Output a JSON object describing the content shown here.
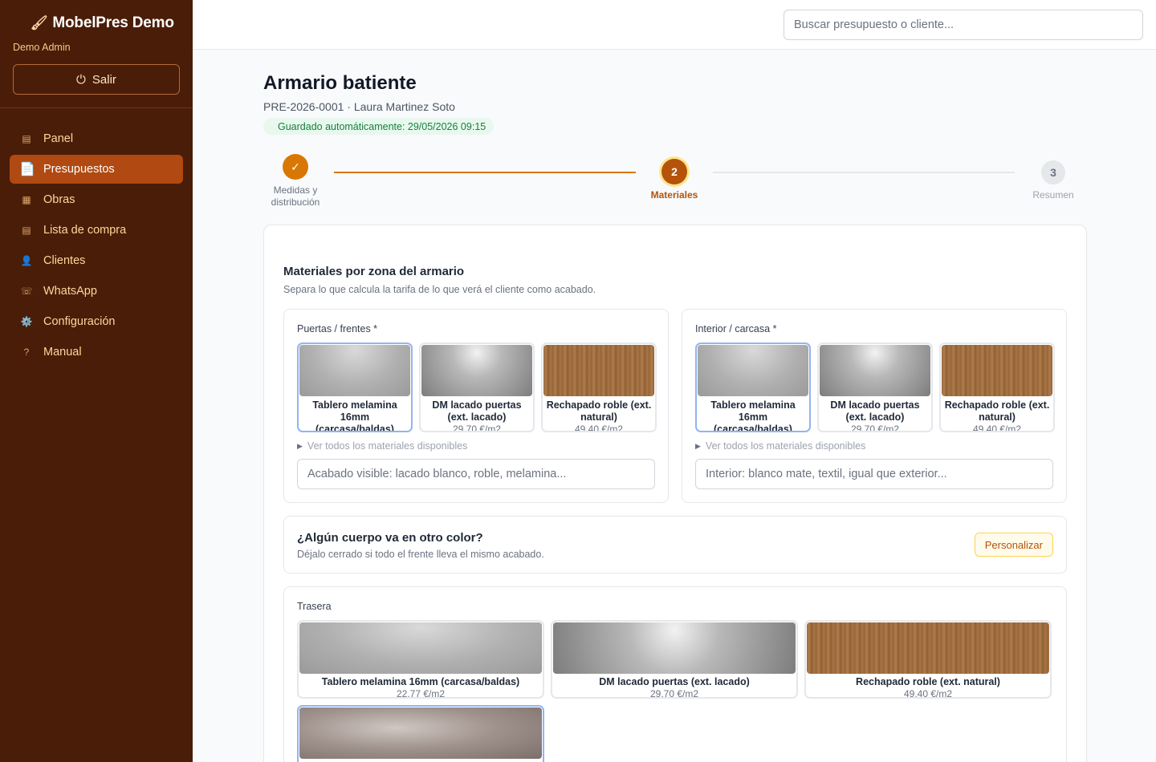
{
  "app": {
    "brand": "MobelPres Demo",
    "user": "Demo Admin",
    "logout_label": "Salir"
  },
  "nav": [
    {
      "label": "Panel",
      "icon": "grid-icon",
      "glyph": "▤"
    },
    {
      "label": "Presupuestos",
      "icon": "document-icon",
      "glyph": "📄"
    },
    {
      "label": "Obras",
      "icon": "building-icon",
      "glyph": "▦"
    },
    {
      "label": "Lista de compra",
      "icon": "list-icon",
      "glyph": "▤"
    },
    {
      "label": "Clientes",
      "icon": "user-icon",
      "glyph": "👤"
    },
    {
      "label": "WhatsApp",
      "icon": "chat-icon",
      "glyph": "☏"
    },
    {
      "label": "Configuración",
      "icon": "gear-icon",
      "glyph": "⚙️"
    },
    {
      "label": "Manual",
      "icon": "help-icon",
      "glyph": "?"
    }
  ],
  "search": {
    "placeholder": "Buscar presupuesto o cliente..."
  },
  "header": {
    "title": "Armario batiente",
    "subtitle": "PRE-2026-0001 · Laura Martinez Soto",
    "autosave": "Guardado automáticamente: 29/05/2026 09:15"
  },
  "stepper": [
    {
      "number": "✓",
      "label": "Medidas y distribución",
      "state": "done"
    },
    {
      "number": "2",
      "label": "Materiales",
      "state": "active"
    },
    {
      "number": "3",
      "label": "Resumen",
      "state": "pending"
    }
  ],
  "materials_section": {
    "title": "Materiales por zona del armario",
    "description": "Separa lo que calcula la tarifa de lo que verá el cliente como acabado."
  },
  "materials": [
    {
      "name": "Tablero melamina 16mm (carcasa/baldas)",
      "price": "22,77 €/m2",
      "texture": "melamina"
    },
    {
      "name": "DM lacado puertas (ext. lacado)",
      "price": "29,70 €/m2",
      "texture": "lacado"
    },
    {
      "name": "Rechapado roble (ext. natural)",
      "price": "49,40 €/m2",
      "texture": "roble"
    }
  ],
  "zones": {
    "puertas": {
      "label": "Puertas / frentes *",
      "ver_todos": "Ver todos los materiales disponibles",
      "placeholder": "Acabado visible: lacado blanco, roble, melamina..."
    },
    "interior": {
      "label": "Interior / carcasa *",
      "ver_todos": "Ver todos los materiales disponibles",
      "placeholder": "Interior: blanco mate, textil, igual que exterior..."
    },
    "trasera": {
      "label": "Trasera"
    }
  },
  "color_option": {
    "title": "¿Algún cuerpo va en otro color?",
    "description": "Déjalo cerrado si todo el frente lleva el mismo acabado.",
    "button": "Personalizar"
  },
  "colors": {
    "sidebar_bg": "#4a1d08",
    "active_nav": "#b04a12",
    "accent": "#d97706",
    "selected_border": "#93b4f0"
  }
}
